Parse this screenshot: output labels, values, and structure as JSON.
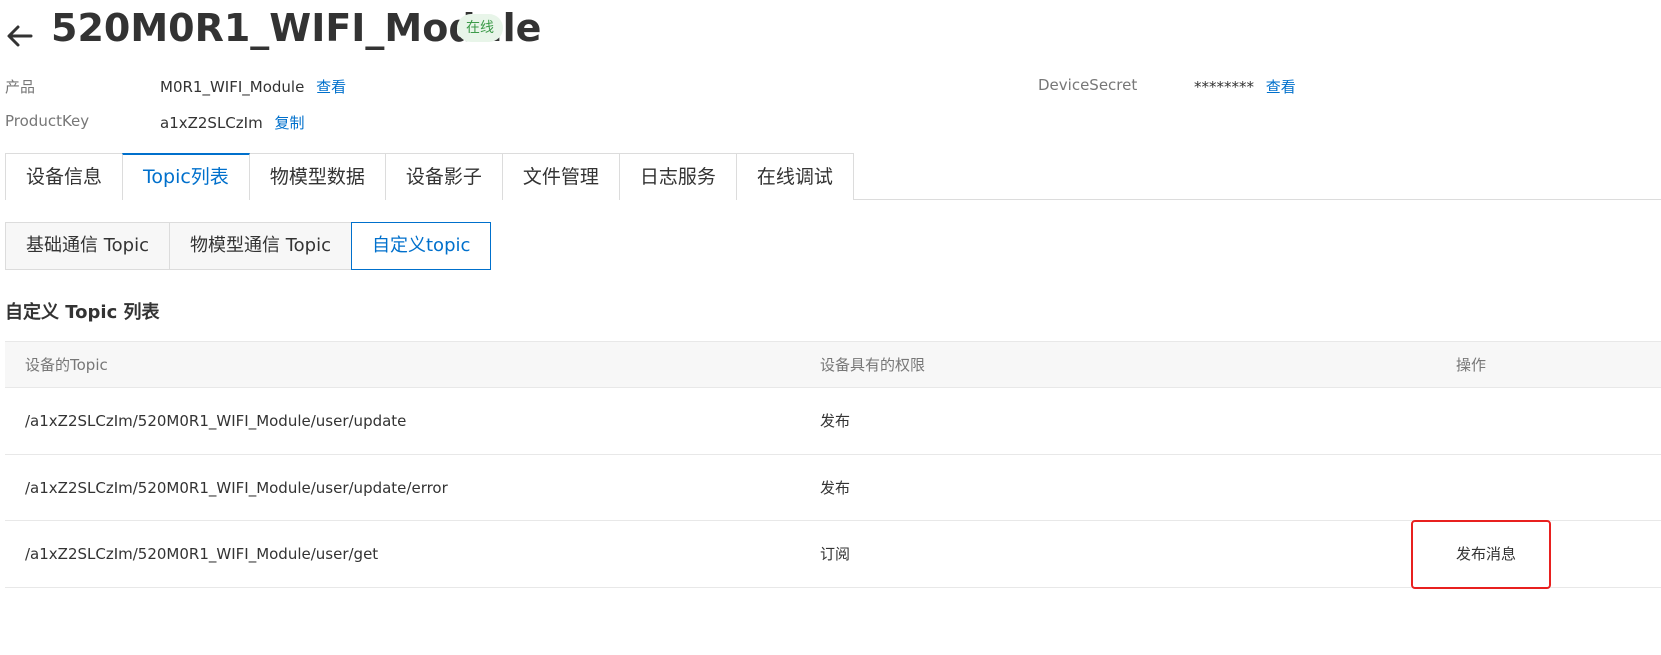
{
  "header": {
    "title": "520M0R1_WIFI_Module",
    "status": "在线"
  },
  "info": {
    "product_label": "产品",
    "product_value": "M0R1_WIFI_Module",
    "product_link": "查看",
    "productkey_label": "ProductKey",
    "productkey_value": "a1xZ2SLCzIm",
    "productkey_link": "复制",
    "secret_label": "DeviceSecret",
    "secret_value": "********",
    "secret_link": "查看"
  },
  "tabs": [
    {
      "label": "设备信息"
    },
    {
      "label": "Topic列表"
    },
    {
      "label": "物模型数据"
    },
    {
      "label": "设备影子"
    },
    {
      "label": "文件管理"
    },
    {
      "label": "日志服务"
    },
    {
      "label": "在线调试"
    }
  ],
  "active_tab": "Topic列表",
  "subtabs": [
    {
      "label": "基础通信 Topic"
    },
    {
      "label": "物模型通信 Topic"
    },
    {
      "label": "自定义topic"
    }
  ],
  "active_subtab": "自定义topic",
  "section": {
    "title": "自定义 Topic 列表"
  },
  "table": {
    "columns": [
      "设备的Topic",
      "设备具有的权限",
      "操作"
    ],
    "rows": [
      {
        "topic": "/a1xZ2SLCzIm/520M0R1_WIFI_Module/user/update",
        "permission": "发布",
        "action": ""
      },
      {
        "topic": "/a1xZ2SLCzIm/520M0R1_WIFI_Module/user/update/error",
        "permission": "发布",
        "action": ""
      },
      {
        "topic": "/a1xZ2SLCzIm/520M0R1_WIFI_Module/user/get",
        "permission": "订阅",
        "action": "发布消息"
      }
    ]
  },
  "colors": {
    "accent": "#0070cc",
    "status_bg": "#e8f5e9",
    "status_text": "#3d9b4a",
    "highlight": "#e8201f"
  },
  "icons": {
    "back": "arrow-left-icon"
  }
}
